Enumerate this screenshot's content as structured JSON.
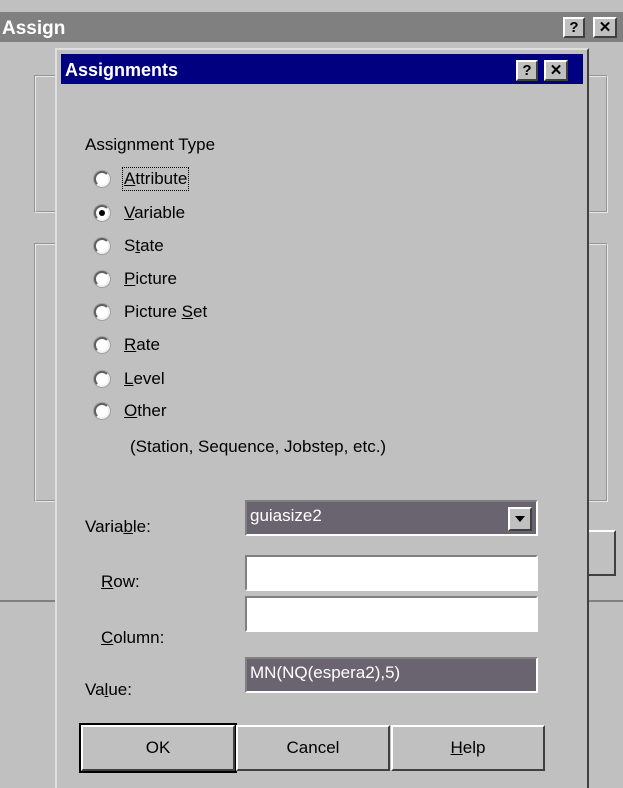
{
  "outer_window": {
    "title": "Assign",
    "help_glyph": "?",
    "close_glyph": "✕"
  },
  "dialog": {
    "title": "Assignments",
    "help_glyph": "?",
    "close_glyph": "✕",
    "assignment_type": {
      "heading": "Assignment Type",
      "selected": "Variable",
      "options": [
        {
          "pre": "",
          "key": "A",
          "post": "ttribute"
        },
        {
          "pre": "",
          "key": "V",
          "post": "ariable"
        },
        {
          "pre": "S",
          "key": "t",
          "post": "ate"
        },
        {
          "pre": "",
          "key": "P",
          "post": "icture"
        },
        {
          "pre": "Picture ",
          "key": "S",
          "post": "et"
        },
        {
          "pre": "",
          "key": "R",
          "post": "ate"
        },
        {
          "pre": "",
          "key": "L",
          "post": "evel"
        },
        {
          "pre": "",
          "key": "O",
          "post": "ther"
        }
      ],
      "other_note": "(Station, Sequence, Jobstep, etc.)"
    },
    "variable": {
      "pre": "Varia",
      "key": "b",
      "post": "le:",
      "value": "guiasize2"
    },
    "row": {
      "pre": "",
      "key": "R",
      "post": "ow:",
      "value": ""
    },
    "column": {
      "pre": "",
      "key": "C",
      "post": "olumn:",
      "value": ""
    },
    "value_field": {
      "pre": "Va",
      "key": "l",
      "post": "ue:",
      "value": "MN(NQ(espera2),5)"
    },
    "buttons": {
      "ok": "OK",
      "cancel": "Cancel",
      "help": {
        "pre": "",
        "key": "H",
        "post": "elp"
      }
    }
  }
}
